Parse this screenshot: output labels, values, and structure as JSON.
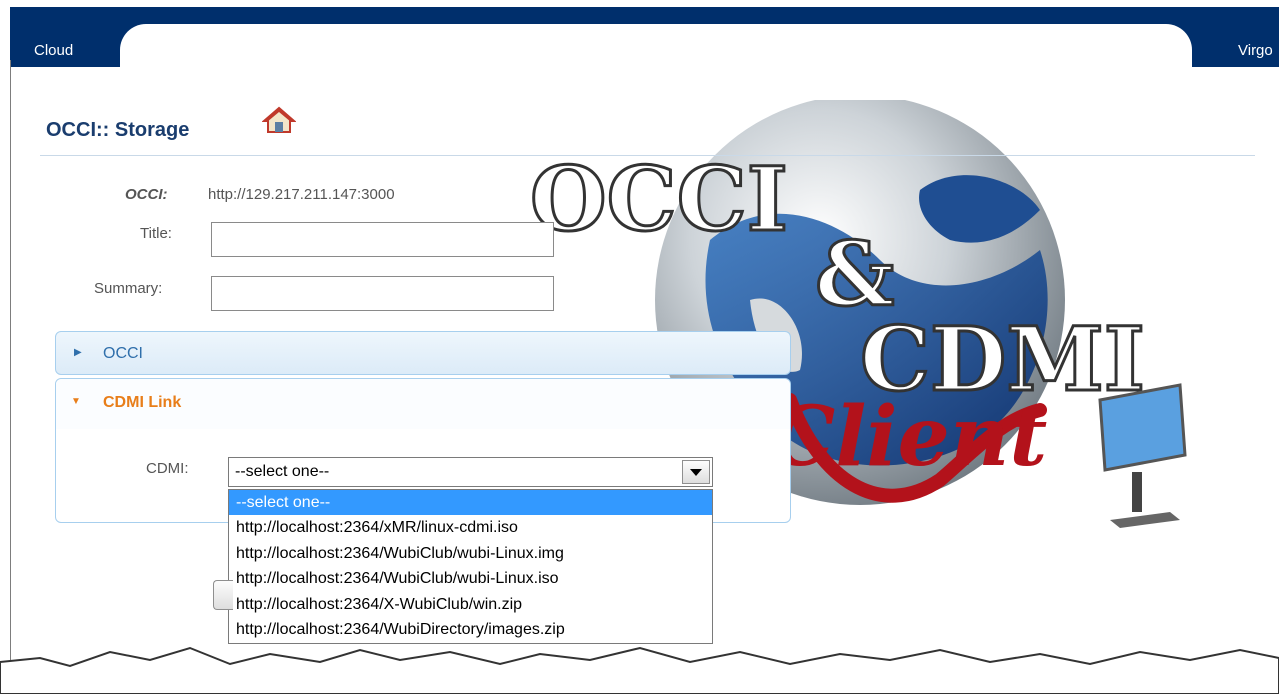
{
  "nav": {
    "left_label": "Cloud",
    "right_label": "Virgo"
  },
  "page": {
    "title": "OCCI:: Storage",
    "home_icon": "home-icon"
  },
  "logo": {
    "line1": "OCCI",
    "line2": "&",
    "line3": "CDMI",
    "script": "Client"
  },
  "form": {
    "occi_label": "OCCI:",
    "occi_value": "http://129.217.211.147:3000",
    "title_label": "Title:",
    "title_value": "",
    "summary_label": "Summary:",
    "summary_value": ""
  },
  "accordion": {
    "occi_label": "OCCI",
    "cdmi_label": "CDMI Link",
    "cdmi_field_label": "CDMI:",
    "selected_value": "--select one--",
    "options": [
      "--select one--",
      "http://localhost:2364/xMR/linux-cdmi.iso",
      "http://localhost:2364/WubiClub/wubi-Linux.img",
      "http://localhost:2364/WubiClub/wubi-Linux.iso",
      "http://localhost:2364/X-WubiClub/win.zip",
      "http://localhost:2364/WubiDirectory/images.zip"
    ]
  },
  "colors": {
    "nav_bg": "#002f6c",
    "title": "#1a3d6e",
    "accent_orange": "#e87e1a",
    "link_blue": "#2f6fab",
    "selection": "#3399ff"
  }
}
